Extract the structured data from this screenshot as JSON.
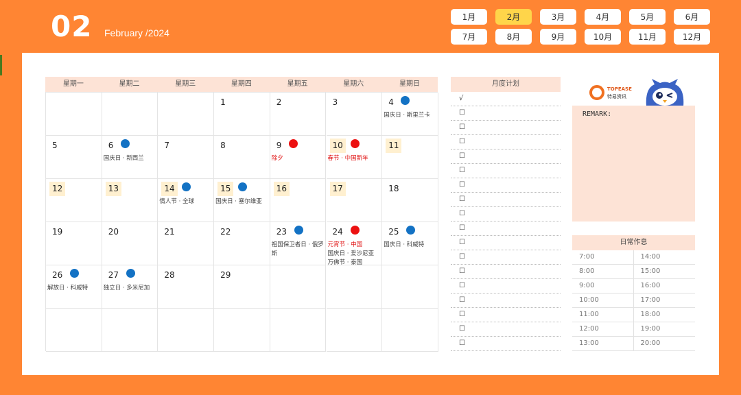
{
  "header": {
    "day": "02",
    "month_text": "February /2024"
  },
  "month_tabs": [
    "1月",
    "2月",
    "3月",
    "4月",
    "5月",
    "6月",
    "7月",
    "8月",
    "9月",
    "10月",
    "11月",
    "12月"
  ],
  "active_month_index": 1,
  "calendar": {
    "weekdays": [
      "星期一",
      "星期二",
      "星期三",
      "星期四",
      "星期五",
      "星期六",
      "星期日"
    ],
    "days": [
      {
        "row": 0,
        "col": 3,
        "day": "1"
      },
      {
        "row": 0,
        "col": 4,
        "day": "2"
      },
      {
        "row": 0,
        "col": 5,
        "day": "3"
      },
      {
        "row": 0,
        "col": 6,
        "day": "4",
        "dot": "blue",
        "events": [
          {
            "text": "国庆日 · 斯里兰卡",
            "style": "gray"
          }
        ]
      },
      {
        "row": 1,
        "col": 0,
        "day": "5"
      },
      {
        "row": 1,
        "col": 1,
        "day": "6",
        "dot": "blue",
        "events": [
          {
            "text": "国庆日 · 新西兰",
            "style": "gray"
          }
        ]
      },
      {
        "row": 1,
        "col": 2,
        "day": "7"
      },
      {
        "row": 1,
        "col": 3,
        "day": "8"
      },
      {
        "row": 1,
        "col": 4,
        "day": "9",
        "dot": "red",
        "events": [
          {
            "text": "除夕",
            "style": "red"
          }
        ]
      },
      {
        "row": 1,
        "col": 5,
        "day": "10",
        "dot": "red",
        "highlight": true,
        "events": [
          {
            "text": "春节 · 中国新年",
            "style": "red"
          }
        ]
      },
      {
        "row": 1,
        "col": 6,
        "day": "11",
        "highlight": true
      },
      {
        "row": 2,
        "col": 0,
        "day": "12",
        "highlight": true
      },
      {
        "row": 2,
        "col": 1,
        "day": "13",
        "highlight": true
      },
      {
        "row": 2,
        "col": 2,
        "day": "14",
        "dot": "blue",
        "highlight": true,
        "events": [
          {
            "text": "情人节 · 全球",
            "style": "gray"
          }
        ]
      },
      {
        "row": 2,
        "col": 3,
        "day": "15",
        "dot": "blue",
        "highlight": true,
        "events": [
          {
            "text": "国庆日 · 塞尔维亚",
            "style": "gray"
          }
        ]
      },
      {
        "row": 2,
        "col": 4,
        "day": "16",
        "highlight": true
      },
      {
        "row": 2,
        "col": 5,
        "day": "17",
        "highlight": true
      },
      {
        "row": 2,
        "col": 6,
        "day": "18"
      },
      {
        "row": 3,
        "col": 0,
        "day": "19"
      },
      {
        "row": 3,
        "col": 1,
        "day": "20"
      },
      {
        "row": 3,
        "col": 2,
        "day": "21"
      },
      {
        "row": 3,
        "col": 3,
        "day": "22"
      },
      {
        "row": 3,
        "col": 4,
        "day": "23",
        "dot": "blue",
        "events": [
          {
            "text": "祖国保卫者日 · 俄罗斯",
            "style": "gray"
          }
        ]
      },
      {
        "row": 3,
        "col": 5,
        "day": "24",
        "dot": "red",
        "events": [
          {
            "text": "元宵节 · 中国",
            "style": "red"
          },
          {
            "text": "国庆日 · 爱沙尼亚",
            "style": "gray"
          },
          {
            "text": "万佛节 · 泰国",
            "style": "gray"
          }
        ]
      },
      {
        "row": 3,
        "col": 6,
        "day": "25",
        "dot": "blue",
        "events": [
          {
            "text": "国庆日 · 科威特",
            "style": "gray"
          }
        ]
      },
      {
        "row": 4,
        "col": 0,
        "day": "26",
        "dot": "blue",
        "events": [
          {
            "text": "解放日 · 科威特",
            "style": "gray"
          }
        ]
      },
      {
        "row": 4,
        "col": 1,
        "day": "27",
        "dot": "blue",
        "events": [
          {
            "text": "独立日 · 多米尼加",
            "style": "gray"
          }
        ]
      },
      {
        "row": 4,
        "col": 2,
        "day": "28"
      },
      {
        "row": 4,
        "col": 3,
        "day": "29"
      }
    ]
  },
  "plan": {
    "title": "月度计划",
    "items": [
      "√",
      "☐",
      "☐",
      "☐",
      "☐",
      "☐",
      "☐",
      "☐",
      "☐",
      "☐",
      "☐",
      "☐",
      "☐",
      "☐",
      "☐",
      "☐",
      "☐",
      "☐"
    ]
  },
  "logo": {
    "brand": "TOPEASE",
    "brand_cn": "特易资讯"
  },
  "remark": {
    "label": "REMARK:"
  },
  "schedule": {
    "title": "日常作息",
    "rows": [
      [
        "7:00",
        "14:00"
      ],
      [
        "8:00",
        "15:00"
      ],
      [
        "9:00",
        "16:00"
      ],
      [
        "10:00",
        "17:00"
      ],
      [
        "11:00",
        "18:00"
      ],
      [
        "12:00",
        "19:00"
      ],
      [
        "13:00",
        "20:00"
      ]
    ]
  },
  "colors": {
    "background": "#ff8533",
    "active_tab": "#ffd54a",
    "header_fill": "#fde3d6",
    "highlight_day": "#fff0d0",
    "dot_blue": "#1372c4",
    "dot_red": "#ec1111"
  }
}
